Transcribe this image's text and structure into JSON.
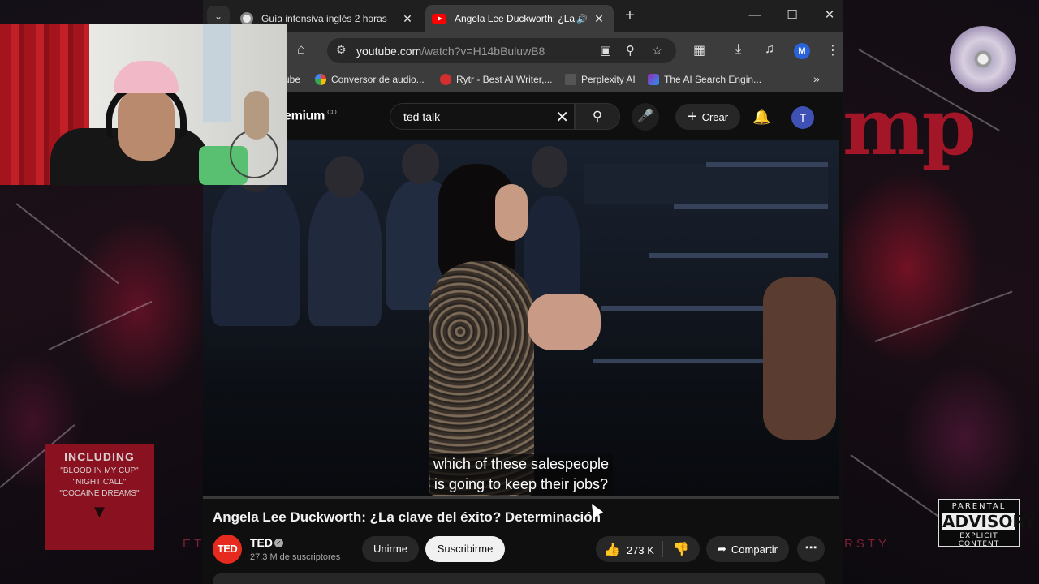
{
  "browser": {
    "tabs": [
      {
        "title": "Guía intensiva inglés 2 horas",
        "active": false
      },
      {
        "title": "Angela Lee Duckworth: ¿La",
        "active": true
      }
    ],
    "url_host": "youtube.com",
    "url_path": "/watch?v=H14bBuluwB8",
    "profile_initial": "M",
    "bookmarks": [
      {
        "label": "ube"
      },
      {
        "label": "Conversor de audio..."
      },
      {
        "label": "Rytr - Best AI Writer,..."
      },
      {
        "label": "Perplexity AI"
      },
      {
        "label": "The AI Search Engin..."
      }
    ]
  },
  "youtube": {
    "logo_text": "emium",
    "logo_region": "CO",
    "search_query": "ted talk",
    "create_label": "Crear",
    "avatar_initial": "T"
  },
  "video": {
    "subtitle_line1": "which of these salespeople",
    "subtitle_line2": "is going to keep their jobs?",
    "title": "Angela Lee Duckworth: ¿La clave del éxito? Determinación",
    "channel_logo": "TED",
    "channel_name": "TED",
    "subscribers": "27,3 M de suscriptores",
    "join_label": "Unirme",
    "subscribe_label": "Suscribirme",
    "likes": "273 K",
    "share_label": "Compartir"
  },
  "background": {
    "album_title": "mp",
    "advisory_top": "PARENTAL",
    "advisory_main": "ADVISORY",
    "advisory_bottom": "EXPLICIT CONTENT",
    "including_title": "INCLUDING",
    "including_line1": "\"BLOOD IN MY CUP\"",
    "including_line2": "\"NIGHT CALL\"",
    "including_line3": "\"COCAINE DREAMS\"",
    "bottom_left": "ET",
    "bottom_right": "RSTY"
  },
  "colors": {
    "youtube_red": "#ff0000",
    "ted_red": "#e62b1e",
    "profile_blue": "#2962d9"
  }
}
